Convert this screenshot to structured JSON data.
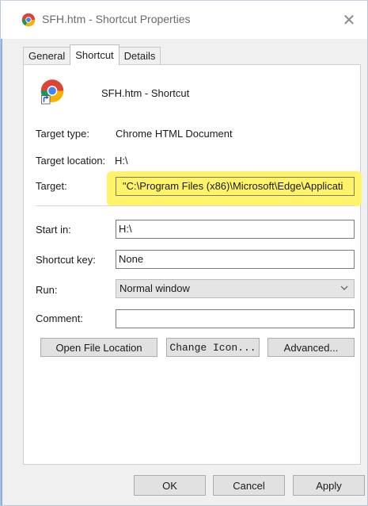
{
  "window": {
    "title": "SFH.htm - Shortcut Properties",
    "close_glyph": "✕"
  },
  "tabs": [
    {
      "label": "General"
    },
    {
      "label": "Shortcut"
    },
    {
      "label": "Details"
    }
  ],
  "active_tab": "Shortcut",
  "header": {
    "name": "SFH.htm - Shortcut",
    "icon": "chrome-icon"
  },
  "properties": {
    "target_type_label": "Target type:",
    "target_type_value": "Chrome HTML Document",
    "target_location_label": "Target location:",
    "target_location_value": "H:\\",
    "target_label": "Target:",
    "target_value": "\"C:\\Program Files (x86)\\Microsoft\\Edge\\Applicati",
    "start_in_label": "Start in:",
    "start_in_value": "H:\\",
    "shortcut_key_label": "Shortcut key:",
    "shortcut_key_value": "None",
    "run_label": "Run:",
    "run_value": "Normal window",
    "comment_label": "Comment:",
    "comment_value": ""
  },
  "actions": {
    "open_file_location": "Open File Location",
    "change_icon": "Change Icon...",
    "advanced": "Advanced..."
  },
  "footer": {
    "ok": "OK",
    "cancel": "Cancel",
    "apply": "Apply"
  },
  "colors": {
    "highlight": "#fff36a",
    "accent": "#3a7bd5"
  }
}
